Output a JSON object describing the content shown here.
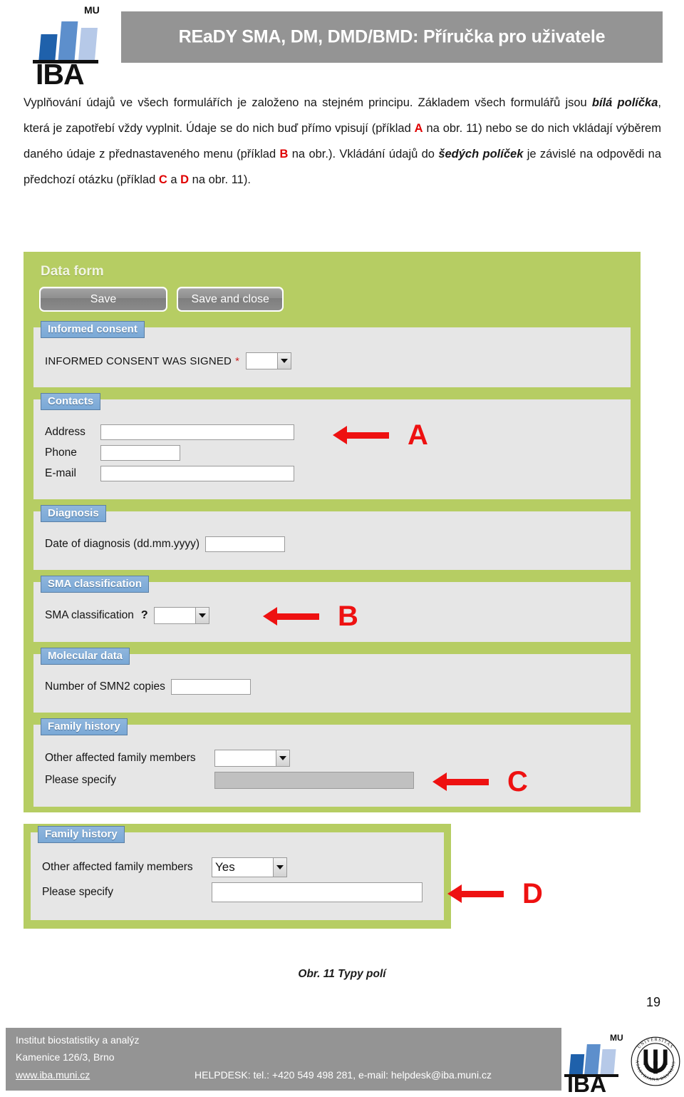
{
  "header": {
    "title": "REaDY SMA, DM, DMD/BMD: Příručka pro uživatele",
    "logo_iba": "IBA",
    "logo_mu": "MU"
  },
  "body": {
    "p1_a": "Vyplňování údajů ve všech formulářích je založeno na stejném principu. Základem všech formulářů jsou ",
    "p1_bold1": "bílá políčka",
    "p1_b": ", která je zapotřebí vždy vyplnit. Údaje se do nich buď přímo vpisují (příklad ",
    "ref_a": "A",
    "p1_c": " na obr. 11) nebo se do nich vkládají výběrem daného údaje z přednastaveného menu (příklad ",
    "ref_b": "B",
    "p1_d": " na obr.). Vkládání údajů do ",
    "p1_bold2": "šedých políček",
    "p1_e": " je závislé na odpovědi na předchozí otázku (příklad ",
    "ref_c": "C",
    "p1_f": " a ",
    "ref_d": "D",
    "p1_g": " na obr. 11)."
  },
  "form": {
    "data_form_title": "Data form",
    "save_label": "Save",
    "save_and_close_label": "Save and close",
    "sections": {
      "informed_consent": {
        "legend": "Informed consent",
        "field_label": "INFORMED CONSENT WAS SIGNED",
        "required_mark": "*",
        "value": ""
      },
      "contacts": {
        "legend": "Contacts",
        "address_label": "Address",
        "address_value": "",
        "phone_label": "Phone",
        "phone_value": "",
        "email_label": "E-mail",
        "email_value": ""
      },
      "diagnosis": {
        "legend": "Diagnosis",
        "date_label": "Date of diagnosis (dd.mm.yyyy)",
        "date_value": ""
      },
      "sma_classification": {
        "legend": "SMA classification",
        "field_label": "SMA classification",
        "help_mark": "?",
        "value": ""
      },
      "molecular_data": {
        "legend": "Molecular data",
        "smn2_label": "Number of SMN2 copies",
        "smn2_value": ""
      },
      "family_history_empty": {
        "legend": "Family history",
        "other_members_label": "Other affected family members",
        "other_members_value": "",
        "specify_label": "Please specify",
        "specify_value": ""
      },
      "family_history_yes": {
        "legend": "Family history",
        "other_members_label": "Other affected family members",
        "other_members_value": "Yes",
        "specify_label": "Please specify",
        "specify_value": ""
      }
    },
    "annotations": {
      "a": "A",
      "b": "B",
      "c": "C",
      "d": "D"
    }
  },
  "caption": "Obr. 11 Typy polí",
  "page_number": "19",
  "footer": {
    "institute": "Institut biostatistiky a analýz",
    "address": "Kamenice 126/3, Brno",
    "website": "www.iba.muni.cz",
    "helpdesk": "HELPDESK: tel.: +420 549 498 281, e-mail: helpdesk@iba.muni.cz",
    "logo_iba": "IBA",
    "logo_mu": "MU",
    "seal_text": "UNIVERSITAS MASARYKIANA BRUNENSIS"
  },
  "colors": {
    "header_gray": "#949494",
    "form_green": "#b6cd63",
    "legend_blue": "#7aa8d6",
    "panel_gray": "#e6e6e6",
    "annotation_red": "#ee1111",
    "logo_blue_dark": "#1f61ab",
    "logo_blue_mid": "#5d8fcc",
    "logo_blue_light": "#b6c9e8"
  }
}
